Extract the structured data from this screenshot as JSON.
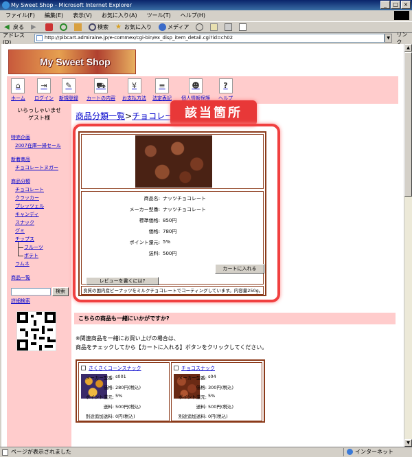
{
  "window": {
    "title": "My Sweet Shop - Microsoft Internet Explorer",
    "menu": [
      "ファイル(F)",
      "編集(E)",
      "表示(V)",
      "お気に入り(A)",
      "ツール(T)",
      "ヘルプ(H)"
    ],
    "toolbar": {
      "back": "戻る",
      "search": "検索",
      "favorites": "お気に入り",
      "media": "メディア"
    },
    "address_label": "アドレス(D)",
    "url": "http://pibcart.admiralne.jp/e-commex/cgi-bin/ex_disp_item_detail.cgi?id=ch02",
    "go_label": "リンク",
    "status": "ページが表示されました",
    "zone": "インターネット"
  },
  "shop": {
    "logo": "My Sweet Shop",
    "nav": [
      {
        "label": "ホーム",
        "icon": "home-icon"
      },
      {
        "label": "ログイン",
        "icon": "login-icon"
      },
      {
        "label": "新規登録",
        "icon": "register-icon"
      },
      {
        "label": "カートの内容",
        "icon": "cart-icon"
      },
      {
        "label": "お支払方法",
        "icon": "payment-icon"
      },
      {
        "label": "法定表記",
        "icon": "legal-icon"
      },
      {
        "label": "個人情報保護",
        "icon": "privacy-icon"
      },
      {
        "label": "ヘルプ",
        "icon": "help-icon"
      }
    ],
    "greeting": [
      "いらっしゃいませ",
      "ゲスト様"
    ],
    "sidebar": {
      "special_head": "特売企画",
      "special_item": "2007在庫一掃セール",
      "new_head": "新着商品",
      "new_item": "チョコレートヌガー",
      "cat_head": "商品分類",
      "cats": [
        "チョコレート",
        "クラッカー",
        "プレッツェル",
        "キャンディ",
        "スナック",
        "グミ",
        "チップス"
      ],
      "subcats": [
        "フルーツ",
        "ポテト"
      ],
      "last_cat": "ラムネ",
      "list_link": "商品一覧",
      "search_btn": "検索",
      "adv_search": "詳細検索"
    },
    "breadcrumb": {
      "root": "商品分類一覧",
      "sep": ">",
      "current": "チョコレート"
    },
    "callout": "該当箇所",
    "product": {
      "specs": [
        {
          "label": "商品名:",
          "value": "ナッツチョコレート"
        },
        {
          "label": "メーカー型番:",
          "value": "ナッツチョコレート"
        },
        {
          "label": "標準価格:",
          "value": "850円"
        },
        {
          "label": "価格:",
          "value": "780円"
        },
        {
          "label": "ポイント還元:",
          "value": "5%"
        },
        {
          "label": "送料:",
          "value": "500円"
        }
      ],
      "cart_btn": "カートに入れる",
      "review_btn": "レビューを書くには?",
      "description": "良質の国内産ピーナッツをミルクチョコレートでコーティングしています。内容量250g。"
    },
    "reco": {
      "head": "こちらの商品も一緒にいかがですか?",
      "note1": "※関連商品を一緒にお買い上げの場合は、",
      "note2": "商品をチェックしてから【カートに入れる】ボタンをクリックしてください。",
      "items": [
        {
          "name": "さくさくコーンスナック",
          "model_label": "メーカー型番:",
          "model": "s001",
          "price_label": "価格:",
          "price": "280円(税込)",
          "point_label": "ポイント還元:",
          "point": "5%",
          "ship_label": "送料:",
          "ship": "500円(税込)",
          "extra_label": "別途追加送料:",
          "extra": "0円(税込)"
        },
        {
          "name": "チョコスナック",
          "model_label": "メーカー型番:",
          "model": "s04",
          "price_label": "価格:",
          "price": "300円(税込)",
          "point_label": "ポイント還元:",
          "point": "5%",
          "ship_label": "送料:",
          "ship": "500円(税込)",
          "extra_label": "別途追加送料:",
          "extra": "0円(税込)"
        }
      ]
    }
  }
}
